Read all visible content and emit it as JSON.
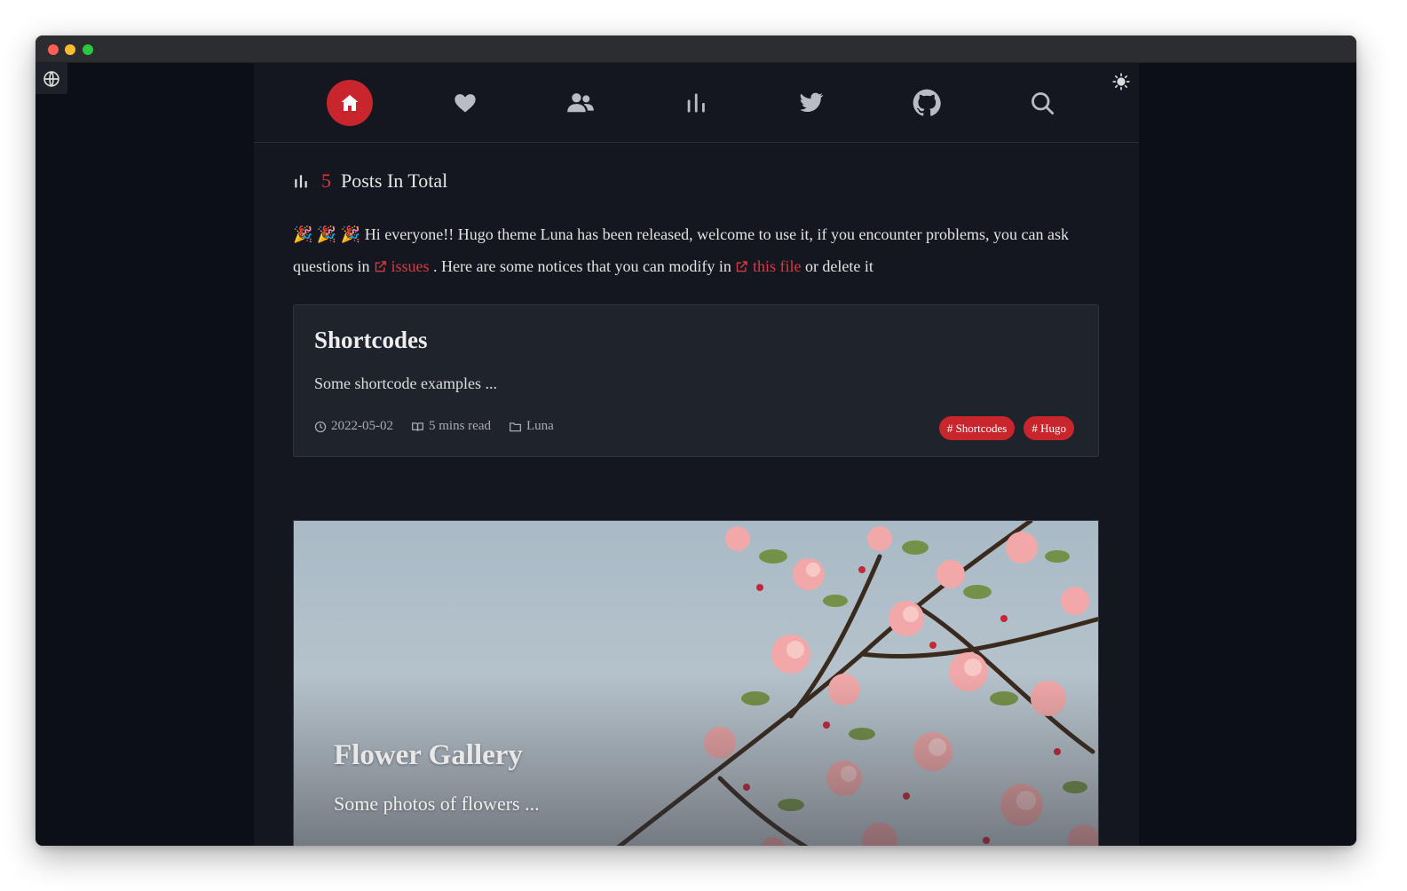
{
  "nav": {
    "items": [
      {
        "name": "home",
        "icon": "home-icon",
        "active": true
      },
      {
        "name": "favorites",
        "icon": "heart-icon"
      },
      {
        "name": "about",
        "icon": "users-icon"
      },
      {
        "name": "archives",
        "icon": "bar-chart-icon"
      },
      {
        "name": "twitter",
        "icon": "twitter-icon"
      },
      {
        "name": "github",
        "icon": "github-icon"
      },
      {
        "name": "search",
        "icon": "search-icon"
      }
    ],
    "accent_color": "#c9252c"
  },
  "summary": {
    "count": "5",
    "label": "Posts In Total"
  },
  "notice": {
    "emojis": "🎉 🎉 🎉",
    "text_1": "Hi everyone!! Hugo theme Luna has been released, welcome to use it, if you encounter problems, you can ask questions in",
    "link_1": "issues",
    "text_2": ". Here are some notices that you can modify in",
    "link_2": "this file",
    "text_3": "or delete it"
  },
  "posts": [
    {
      "title": "Shortcodes",
      "summary": "Some shortcode examples ...",
      "date": "2022-05-02",
      "read_time": "5 mins read",
      "category": "Luna",
      "tags": [
        "# Shortcodes",
        "# Hugo"
      ]
    },
    {
      "title": "Flower Gallery",
      "summary": "Some photos of flowers ..."
    }
  ]
}
